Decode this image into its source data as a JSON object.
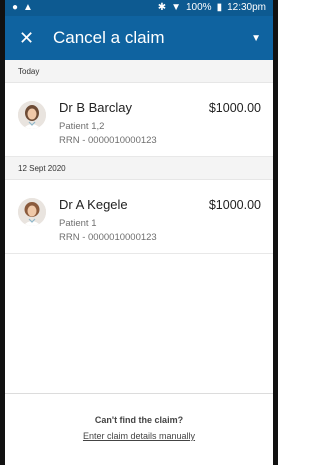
{
  "status_bar": {
    "left_icons": [
      "info-icon",
      "warning-icon"
    ],
    "right_icons": [
      "bluetooth-icon",
      "wifi-icon",
      "battery-icon"
    ],
    "battery": "100%",
    "time": "12:30pm"
  },
  "header": {
    "title": "Cancel a claim",
    "accent_color": "#0f63a0"
  },
  "sections": [
    {
      "date": "Today",
      "claims": [
        {
          "doctor": "Dr B Barclay",
          "amount": "$1000.00",
          "patient": "Patient 1,2",
          "rrn": "RRN - 0000010000123"
        }
      ]
    },
    {
      "date": "12 Sept 2020",
      "claims": [
        {
          "doctor": "Dr A Kegele",
          "amount": "$1000.00",
          "patient": "Patient 1",
          "rrn": "RRN - 0000010000123"
        }
      ]
    }
  ],
  "footer": {
    "prompt": "Can't find the claim?",
    "link": "Enter claim details manually"
  }
}
